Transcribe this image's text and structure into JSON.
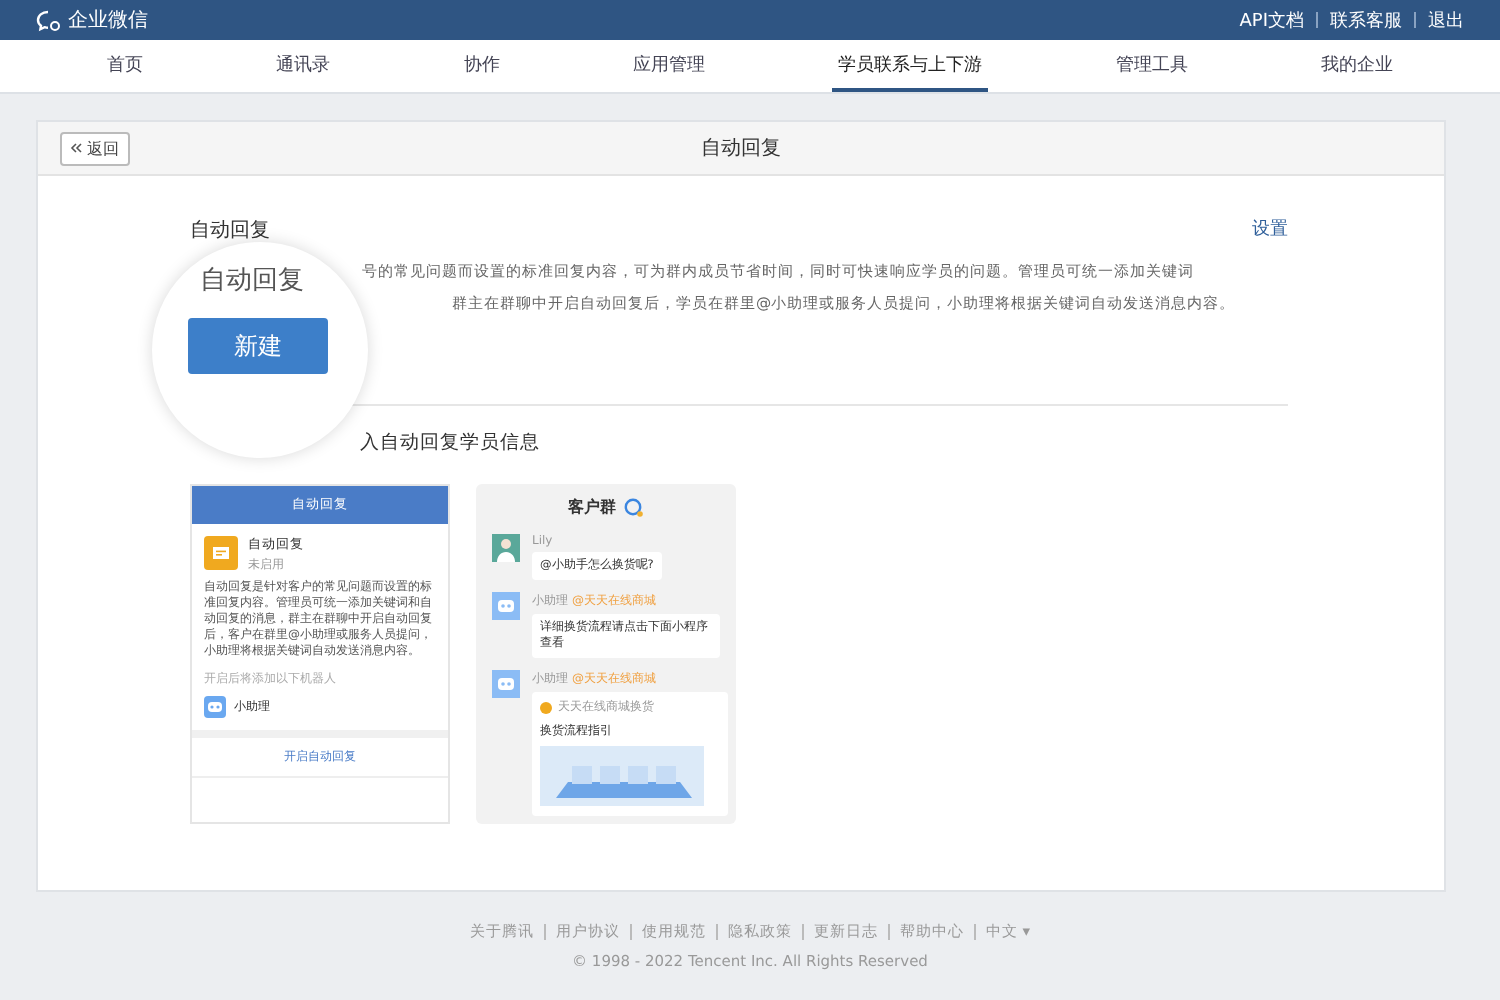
{
  "topbar": {
    "brand": "企业微信",
    "links": [
      "API文档",
      "联系客服",
      "退出"
    ]
  },
  "tabs": [
    {
      "label": "首页",
      "selected": false
    },
    {
      "label": "通讯录",
      "selected": false
    },
    {
      "label": "协作",
      "selected": false
    },
    {
      "label": "应用管理",
      "selected": false
    },
    {
      "label": "学员联系与上下游",
      "selected": true
    },
    {
      "label": "管理工具",
      "selected": false
    },
    {
      "label": "我的企业",
      "selected": false
    }
  ],
  "card": {
    "back": "返回",
    "title": "自动回复"
  },
  "section": {
    "title": "自动回复",
    "settings": "设置",
    "description": [
      "号的常见问题而设置的标准回复内容，可为群内成员节省时间，同时可快速响应学员的问题。管理员可统一添加关键词",
      "群主在群聊中开启自动回复后，学员在群里@小助理或服务人员提问，小助理将根据关键词自动发送消息内容。"
    ]
  },
  "magnifier": {
    "zoomed_text": "自动回复",
    "button": "新建"
  },
  "preview": {
    "heading": "入自动回复学员信息",
    "left_phone": {
      "header": "自动回复",
      "app_name": "自动回复",
      "app_status": "未启用",
      "body": "自动回复是针对客户的常见问题而设置的标准回复内容。管理员可统一添加关键词和自动回复的消息，群主在群聊中开启自动回复后，客户在群里@小助理或服务人员提问，小助理将根据关键词自动发送消息内容。",
      "hint": "开启后将添加以下机器人",
      "bot": "小助理",
      "action": "开启自动回复"
    },
    "right_phone": {
      "title": "客户群",
      "messages": [
        {
          "kind": "person",
          "sender": "Lily",
          "text": "@小助手怎么换货呢?"
        },
        {
          "kind": "bot",
          "sender": "小助理",
          "tag": "@天天在线商城",
          "text": "详细换货流程请点击下面小程序查看"
        },
        {
          "kind": "miniapp",
          "sender": "小助理",
          "tag": "@天天在线商城",
          "source": "天天在线商城换货",
          "text": "换货流程指引"
        }
      ]
    }
  },
  "footer": {
    "links": [
      "关于腾讯",
      "用户协议",
      "使用规范",
      "隐私政策",
      "更新日志",
      "帮助中心"
    ],
    "language": "中文 ▾",
    "copyright": "© 1998 - 2022 Tencent Inc. All Rights Reserved"
  }
}
